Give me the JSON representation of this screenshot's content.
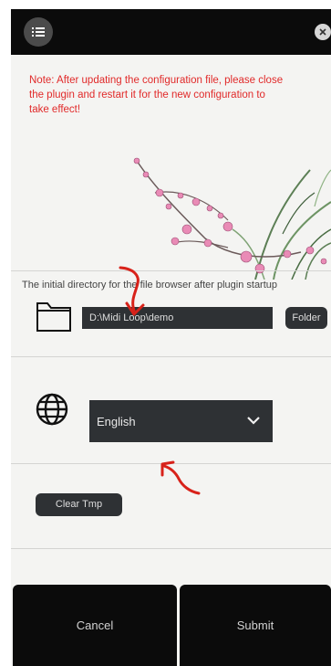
{
  "header": {
    "menu_icon": "list-icon",
    "close_icon": "close-icon"
  },
  "notice": {
    "text": "Note: After updating the configuration file, please close the plugin and restart it for the new configuration to take effect!",
    "color": "#e12a2a"
  },
  "directory": {
    "description": "The initial directory for the file browser after plugin startup",
    "path_value": "D:\\Midi Loop\\demo",
    "folder_button_label": "Folder",
    "icon": "folder-icon"
  },
  "language": {
    "icon": "globe-icon",
    "selected": "English"
  },
  "actions": {
    "clear_tmp_label": "Clear Tmp"
  },
  "footer": {
    "cancel_label": "Cancel",
    "submit_label": "Submit"
  },
  "colors": {
    "panel_bg": "#f4f4f2",
    "bar_bg": "#0b0b0b",
    "control_bg": "#2e3134",
    "annotation": "#d8221a"
  }
}
